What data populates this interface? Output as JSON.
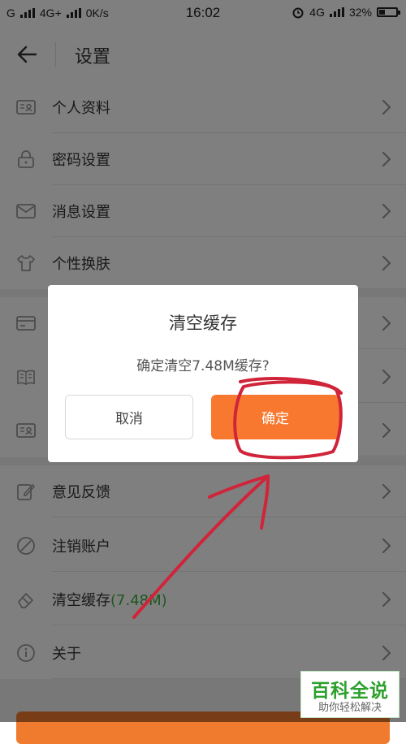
{
  "status_bar": {
    "carrier": "G",
    "network": "4G+",
    "speed": "0K/s",
    "time": "16:02",
    "network_right": "4G",
    "battery": "32%"
  },
  "header": {
    "title": "设置"
  },
  "settings": {
    "items": [
      {
        "label": "个人资料",
        "icon": "id-card-icon"
      },
      {
        "label": "密码设置",
        "icon": "lock-icon"
      },
      {
        "label": "消息设置",
        "icon": "envelope-icon"
      },
      {
        "label": "个性换肤",
        "icon": "shirt-icon"
      },
      {
        "label": "",
        "icon": "card-icon"
      },
      {
        "label": "",
        "icon": "book-icon"
      },
      {
        "label": "",
        "icon": "id-card-icon"
      },
      {
        "label": "意见反馈",
        "icon": "edit-icon"
      },
      {
        "label": "注销账户",
        "icon": "ban-icon"
      },
      {
        "label": "清空缓存",
        "size": "(7.48M)",
        "icon": "eraser-icon"
      },
      {
        "label": "关于",
        "icon": "info-icon"
      }
    ]
  },
  "dialog": {
    "title": "清空缓存",
    "message": "确定清空7.48M缓存?",
    "cancel_label": "取消",
    "confirm_label": "确定"
  },
  "watermark": {
    "title": "百科全说",
    "subtitle": "助你轻松解决"
  },
  "colors": {
    "accent": "#f7782e",
    "annotation": "#d0243a",
    "cache_size": "#3fae3f"
  }
}
